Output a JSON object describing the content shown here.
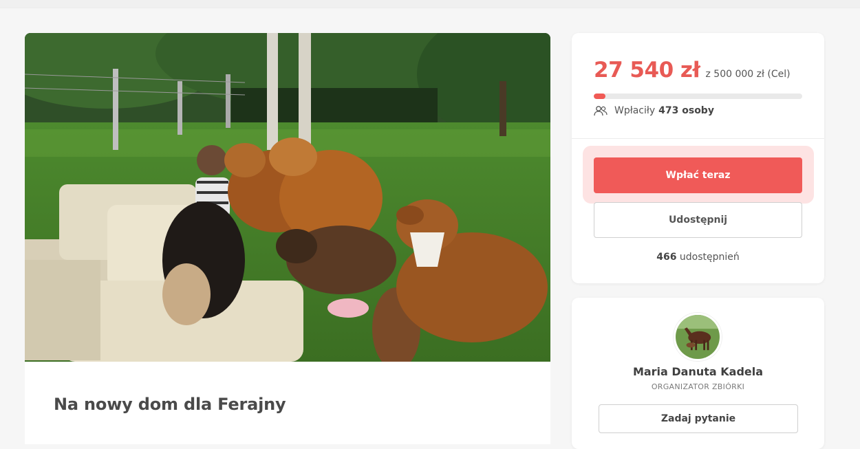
{
  "campaign": {
    "title": "Na nowy dom dla Ferajny",
    "image_alt": "Dogs gathered around a person on an outdoor sofa"
  },
  "donation": {
    "amount": "27 540 zł",
    "goal": "z 500 000 zł (Cel)",
    "progress_fraction": 0.055,
    "donors_label": "Wpłaciły",
    "donors_count": "473 osoby",
    "donate_button": "Wpłać teraz",
    "share_button": "Udostępnij",
    "shares_count": "466",
    "shares_label": "udostępnień"
  },
  "organizer": {
    "name": "Maria Danuta Kadela",
    "role": "ORGANIZATOR ZBIÓRKI",
    "ask_button": "Zadaj pytanie"
  },
  "colors": {
    "accent": "#f05a58",
    "accent_halo": "#fde3e3",
    "page_bg": "#f6f6f6"
  }
}
